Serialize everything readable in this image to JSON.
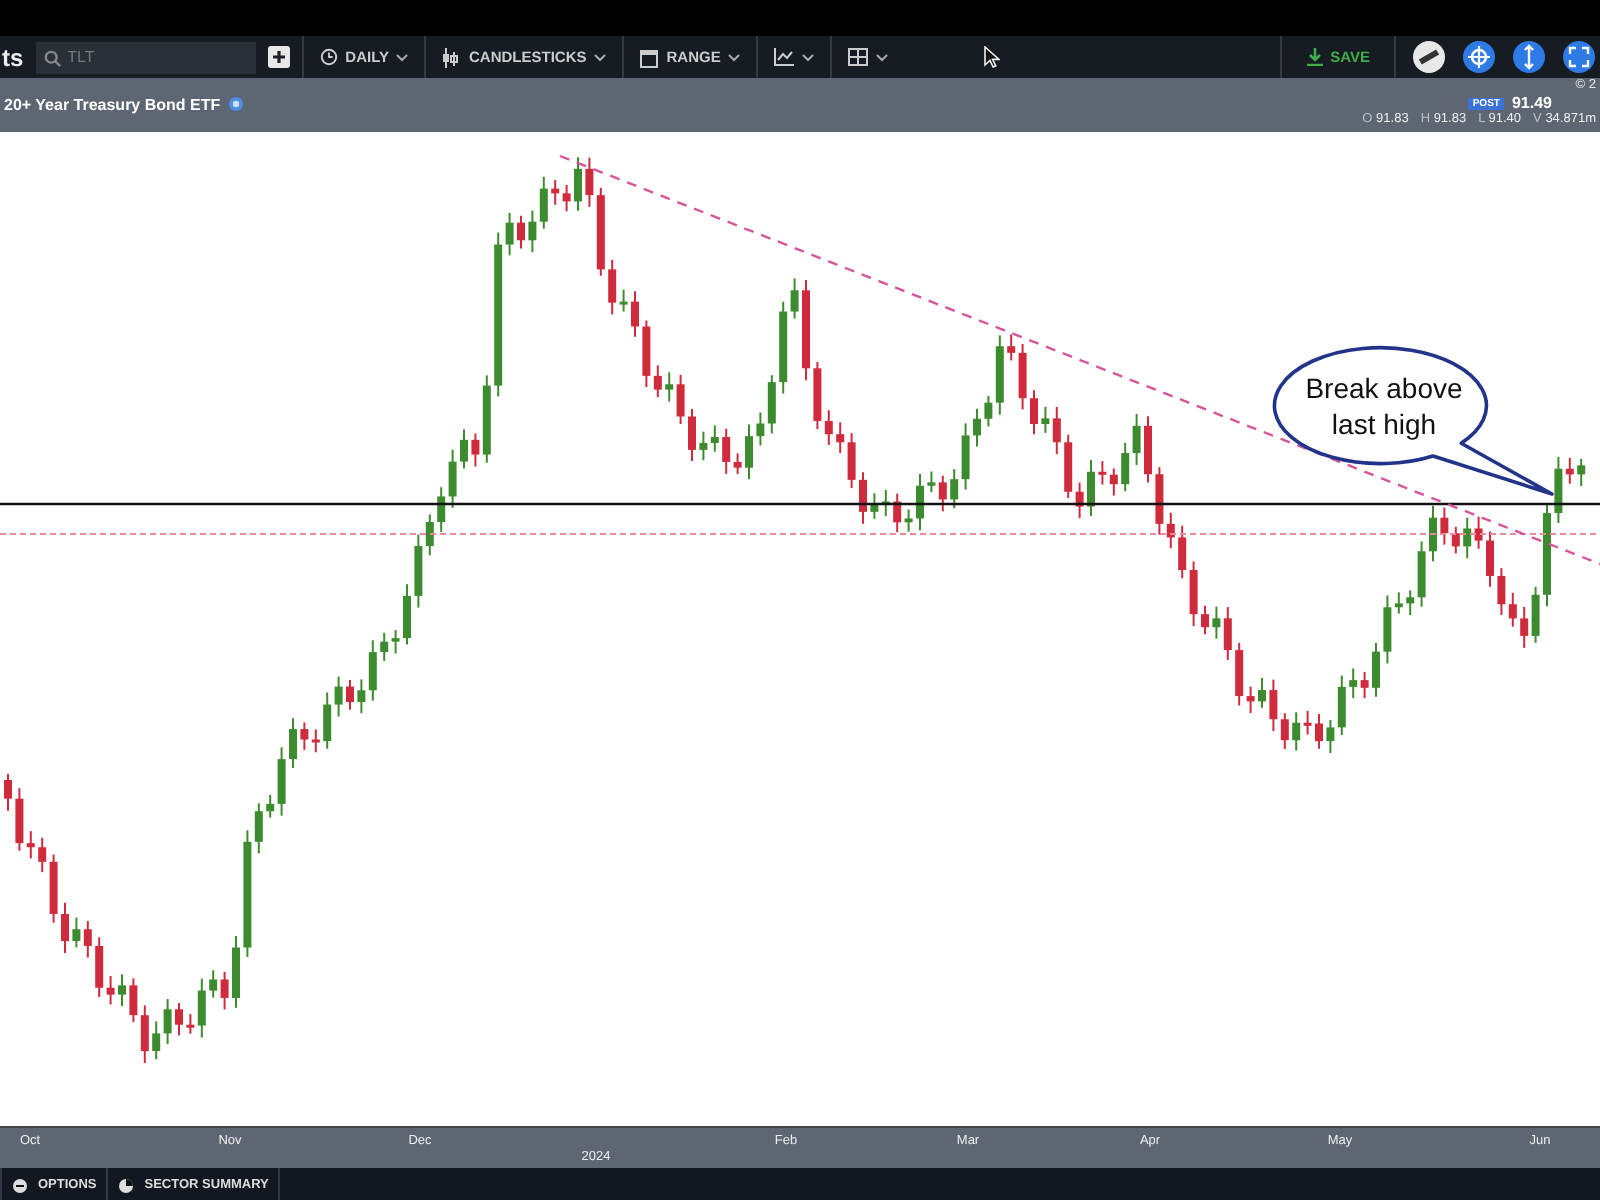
{
  "toolbar": {
    "title_fragment": "ts",
    "search": {
      "placeholder": "TLT"
    },
    "menus": [
      {
        "kind": "clock",
        "label": "DAILY"
      },
      {
        "kind": "candle",
        "label": "CANDLESTICKS"
      },
      {
        "kind": "calendar",
        "label": "RANGE"
      },
      {
        "kind": "linechart"
      },
      {
        "kind": "grid"
      }
    ],
    "save": {
      "label": "SAVE"
    }
  },
  "header": {
    "name": "20+ Year Treasury Bond ETF",
    "copyright": "© 2",
    "session": "POST",
    "price": "91.49",
    "ohlc": [
      {
        "key": "O",
        "value": "91.83"
      },
      {
        "key": "H",
        "value": "91.83"
      },
      {
        "key": "L",
        "value": "91.40"
      },
      {
        "key": "V",
        "value": "34.871m"
      }
    ]
  },
  "chart": {
    "annotation": "Break above last high",
    "x_axis": [
      {
        "label": "Oct",
        "kind": "month"
      },
      {
        "label": "Nov",
        "kind": "month"
      },
      {
        "label": "Dec",
        "kind": "month"
      },
      {
        "label": "2024",
        "kind": "year"
      },
      {
        "label": "Feb",
        "kind": "month"
      },
      {
        "label": "Mar",
        "kind": "month"
      },
      {
        "label": "Apr",
        "kind": "month"
      },
      {
        "label": "May",
        "kind": "month"
      },
      {
        "label": "Jun",
        "kind": "month"
      }
    ]
  },
  "bottom_bar": {
    "items": [
      {
        "kind": "options",
        "label": "OPTIONS"
      },
      {
        "kind": "sector",
        "label": "SECTOR SUMMARY"
      }
    ]
  }
}
